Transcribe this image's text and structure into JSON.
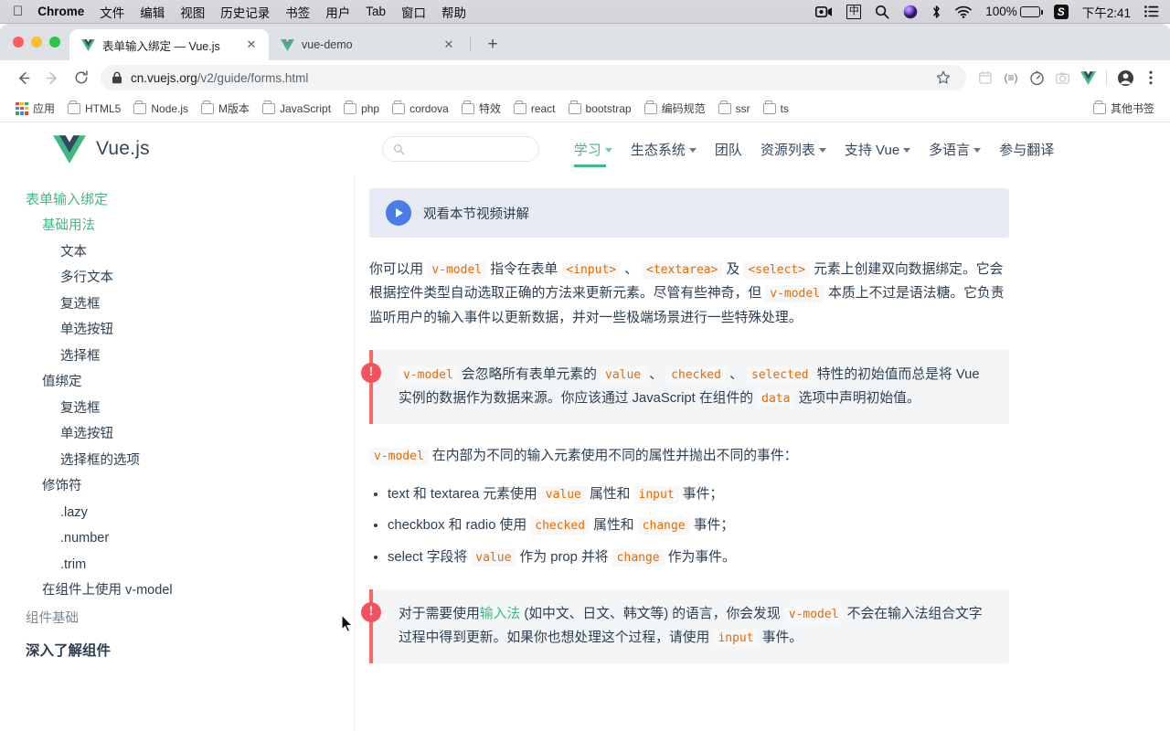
{
  "macbar": {
    "apple_icon": "apple-icon",
    "items": [
      {
        "label": "Chrome",
        "bold": true
      },
      {
        "label": "文件",
        "bold": false
      },
      {
        "label": "编辑",
        "bold": false
      },
      {
        "label": "视图",
        "bold": false
      },
      {
        "label": "历史记录",
        "bold": false
      },
      {
        "label": "书签",
        "bold": false
      },
      {
        "label": "用户",
        "bold": false
      },
      {
        "label": "Tab",
        "bold": false
      },
      {
        "label": "窗口",
        "bold": false
      },
      {
        "label": "帮助",
        "bold": false
      }
    ],
    "status": {
      "screen_record_icon": "screen-record-icon",
      "input_method": "中",
      "search_icon": "search-icon",
      "siri_icon": "siri-icon",
      "bluetooth_icon": "bluetooth-icon",
      "wifi_icon": "wifi-icon",
      "battery_percent": "100%",
      "battery_icon": "battery-charging-icon",
      "sogou": "S",
      "time": "下午2:41",
      "control_center_icon": "control-center-icon"
    }
  },
  "tabs": [
    {
      "title": "表单输入绑定 — Vue.js",
      "active": true,
      "favicon": "vue-logo-icon"
    },
    {
      "title": "vue-demo",
      "active": false,
      "favicon": "vue-logo-icon"
    }
  ],
  "tabstrip": {
    "new_tab_label": "+"
  },
  "toolbar": {
    "back_icon": "back-arrow-icon",
    "forward_icon": "forward-arrow-icon",
    "reload_icon": "reload-icon",
    "lock_icon": "lock-icon",
    "url_host": "cn.vuejs.org",
    "url_path": "/v2/guide/forms.html",
    "url_full": "cn.vuejs.org/v2/guide/forms.html",
    "bookmark_star_icon": "star-icon",
    "extensions": [
      {
        "name": "calendar-extension-icon",
        "glyph": "▤"
      },
      {
        "name": "list-extension-icon",
        "glyph": "(≡)"
      },
      {
        "name": "speed-extension-icon",
        "glyph": "◷"
      },
      {
        "name": "camera-extension-icon",
        "glyph": "◎"
      },
      {
        "name": "vue-devtools-icon",
        "glyph": "V"
      }
    ],
    "profile_icon": "profile-avatar-icon",
    "menu_icon": "three-dot-menu-icon"
  },
  "bookmarks": {
    "apps_label": "应用",
    "items": [
      "HTML5",
      "Node.js",
      "M版本",
      "JavaScript",
      "php",
      "cordova",
      "特效",
      "react",
      "bootstrap",
      "编码规范",
      "ssr",
      "ts"
    ],
    "other": "其他书签"
  },
  "site": {
    "brand": "Vue.js",
    "logo_icon": "vue-logo-icon",
    "search_placeholder": "",
    "search_icon": "search-icon",
    "nav": [
      {
        "label": "学习",
        "caret": true,
        "active": true
      },
      {
        "label": "生态系统",
        "caret": true,
        "active": false
      },
      {
        "label": "团队",
        "caret": false,
        "active": false
      },
      {
        "label": "资源列表",
        "caret": true,
        "active": false
      },
      {
        "label": "支持 Vue",
        "caret": true,
        "active": false
      },
      {
        "label": "多语言",
        "caret": true,
        "active": false
      },
      {
        "label": "参与翻译",
        "caret": false,
        "active": false
      }
    ]
  },
  "sidebar": {
    "items": [
      {
        "label": "表单输入绑定",
        "level": "a"
      },
      {
        "label": "基础用法",
        "level": "b"
      },
      {
        "label": "文本",
        "level": "c"
      },
      {
        "label": "多行文本",
        "level": "c"
      },
      {
        "label": "复选框",
        "level": "c"
      },
      {
        "label": "单选按钮",
        "level": "c"
      },
      {
        "label": "选择框",
        "level": "c"
      },
      {
        "label": "值绑定",
        "level": "b2"
      },
      {
        "label": "复选框",
        "level": "c"
      },
      {
        "label": "单选按钮",
        "level": "c"
      },
      {
        "label": "选择框的选项",
        "level": "c"
      },
      {
        "label": "修饰符",
        "level": "b2"
      },
      {
        "label": ".lazy",
        "level": "c"
      },
      {
        "label": ".number",
        "level": "c"
      },
      {
        "label": ".trim",
        "level": "c"
      },
      {
        "label": "在组件上使用 v-model",
        "level": "b2"
      },
      {
        "label": "组件基础",
        "level": "top"
      },
      {
        "label": "深入了解组件",
        "level": "bold"
      }
    ]
  },
  "main": {
    "video_banner": {
      "label": "观看本节视频讲解",
      "play_icon": "play-icon"
    },
    "intro": {
      "t1": "你可以用 ",
      "c1": "v-model",
      "t2": " 指令在表单 ",
      "c2": "<input>",
      "t3": " 、 ",
      "c3": "<textarea>",
      "t4": " 及 ",
      "c4": "<select>",
      "t5": " 元素上创建双向数据绑定。它会根据控件类型自动选取正确的方法来更新元素。尽管有些神奇，但 ",
      "c5": "v-model",
      "t6": " 本质上不过是语法糖。它负责监听用户的输入事件以更新数据，并对一些极端场景进行一些特殊处理。"
    },
    "tip1": {
      "icon": "warning-icon",
      "c1": "v-model",
      "t1": " 会忽略所有表单元素的 ",
      "c2": "value",
      "t2": " 、 ",
      "c3": "checked",
      "t3": " 、 ",
      "c4": "selected",
      "t4": " 特性的初始值而总是将 Vue 实例的数据作为数据来源。你应该通过 JavaScript 在组件的 ",
      "c5": "data",
      "t5": " 选项中声明初始值。"
    },
    "para2": {
      "c1": "v-model",
      "t1": " 在内部为不同的输入元素使用不同的属性并抛出不同的事件："
    },
    "bullets": [
      {
        "t1": "text 和 textarea 元素使用 ",
        "c1": "value",
        "t2": " 属性和 ",
        "c2": "input",
        "t3": " 事件；"
      },
      {
        "t1": "checkbox 和 radio 使用 ",
        "c1": "checked",
        "t2": " 属性和 ",
        "c2": "change",
        "t3": " 事件；"
      },
      {
        "t1": "select 字段将 ",
        "c1": "value",
        "t2": " 作为 prop 并将 ",
        "c2": "change",
        "t3": " 作为事件。"
      }
    ],
    "tip2": {
      "icon": "warning-icon",
      "t1": "对于需要使用",
      "link": "输入法",
      "t2": " (如中文、日文、韩文等) 的语言，你会发现 ",
      "c1": "v-model",
      "t3": " 不会在输入法组合文字过程中得到更新。如果你也想处理这个过程，请使用 ",
      "c2": "input",
      "t4": " 事件。"
    }
  },
  "colors": {
    "vue_green": "#42b983",
    "code_orange": "#e96900",
    "tip_red": "#f66",
    "banner_blue": "#4a7de8",
    "text": "#2c3e50"
  }
}
